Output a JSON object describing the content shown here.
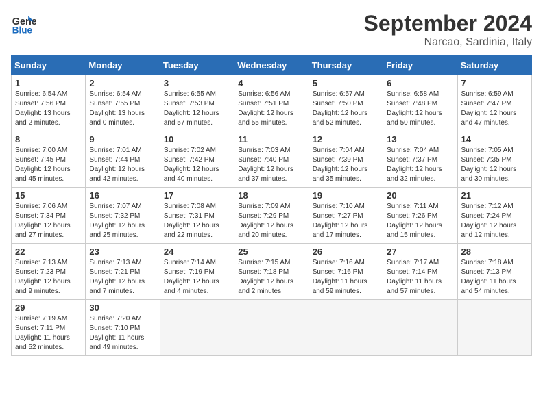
{
  "header": {
    "logo_line1": "General",
    "logo_line2": "Blue",
    "month": "September 2024",
    "location": "Narcao, Sardinia, Italy"
  },
  "weekdays": [
    "Sunday",
    "Monday",
    "Tuesday",
    "Wednesday",
    "Thursday",
    "Friday",
    "Saturday"
  ],
  "weeks": [
    [
      {
        "num": "1",
        "rise": "6:54 AM",
        "set": "7:56 PM",
        "daylight": "13 hours and 2 minutes."
      },
      {
        "num": "2",
        "rise": "6:54 AM",
        "set": "7:55 PM",
        "daylight": "13 hours and 0 minutes."
      },
      {
        "num": "3",
        "rise": "6:55 AM",
        "set": "7:53 PM",
        "daylight": "12 hours and 57 minutes."
      },
      {
        "num": "4",
        "rise": "6:56 AM",
        "set": "7:51 PM",
        "daylight": "12 hours and 55 minutes."
      },
      {
        "num": "5",
        "rise": "6:57 AM",
        "set": "7:50 PM",
        "daylight": "12 hours and 52 minutes."
      },
      {
        "num": "6",
        "rise": "6:58 AM",
        "set": "7:48 PM",
        "daylight": "12 hours and 50 minutes."
      },
      {
        "num": "7",
        "rise": "6:59 AM",
        "set": "7:47 PM",
        "daylight": "12 hours and 47 minutes."
      }
    ],
    [
      {
        "num": "8",
        "rise": "7:00 AM",
        "set": "7:45 PM",
        "daylight": "12 hours and 45 minutes."
      },
      {
        "num": "9",
        "rise": "7:01 AM",
        "set": "7:44 PM",
        "daylight": "12 hours and 42 minutes."
      },
      {
        "num": "10",
        "rise": "7:02 AM",
        "set": "7:42 PM",
        "daylight": "12 hours and 40 minutes."
      },
      {
        "num": "11",
        "rise": "7:03 AM",
        "set": "7:40 PM",
        "daylight": "12 hours and 37 minutes."
      },
      {
        "num": "12",
        "rise": "7:04 AM",
        "set": "7:39 PM",
        "daylight": "12 hours and 35 minutes."
      },
      {
        "num": "13",
        "rise": "7:04 AM",
        "set": "7:37 PM",
        "daylight": "12 hours and 32 minutes."
      },
      {
        "num": "14",
        "rise": "7:05 AM",
        "set": "7:35 PM",
        "daylight": "12 hours and 30 minutes."
      }
    ],
    [
      {
        "num": "15",
        "rise": "7:06 AM",
        "set": "7:34 PM",
        "daylight": "12 hours and 27 minutes."
      },
      {
        "num": "16",
        "rise": "7:07 AM",
        "set": "7:32 PM",
        "daylight": "12 hours and 25 minutes."
      },
      {
        "num": "17",
        "rise": "7:08 AM",
        "set": "7:31 PM",
        "daylight": "12 hours and 22 minutes."
      },
      {
        "num": "18",
        "rise": "7:09 AM",
        "set": "7:29 PM",
        "daylight": "12 hours and 20 minutes."
      },
      {
        "num": "19",
        "rise": "7:10 AM",
        "set": "7:27 PM",
        "daylight": "12 hours and 17 minutes."
      },
      {
        "num": "20",
        "rise": "7:11 AM",
        "set": "7:26 PM",
        "daylight": "12 hours and 15 minutes."
      },
      {
        "num": "21",
        "rise": "7:12 AM",
        "set": "7:24 PM",
        "daylight": "12 hours and 12 minutes."
      }
    ],
    [
      {
        "num": "22",
        "rise": "7:13 AM",
        "set": "7:23 PM",
        "daylight": "12 hours and 9 minutes."
      },
      {
        "num": "23",
        "rise": "7:13 AM",
        "set": "7:21 PM",
        "daylight": "12 hours and 7 minutes."
      },
      {
        "num": "24",
        "rise": "7:14 AM",
        "set": "7:19 PM",
        "daylight": "12 hours and 4 minutes."
      },
      {
        "num": "25",
        "rise": "7:15 AM",
        "set": "7:18 PM",
        "daylight": "12 hours and 2 minutes."
      },
      {
        "num": "26",
        "rise": "7:16 AM",
        "set": "7:16 PM",
        "daylight": "11 hours and 59 minutes."
      },
      {
        "num": "27",
        "rise": "7:17 AM",
        "set": "7:14 PM",
        "daylight": "11 hours and 57 minutes."
      },
      {
        "num": "28",
        "rise": "7:18 AM",
        "set": "7:13 PM",
        "daylight": "11 hours and 54 minutes."
      }
    ],
    [
      {
        "num": "29",
        "rise": "7:19 AM",
        "set": "7:11 PM",
        "daylight": "11 hours and 52 minutes."
      },
      {
        "num": "30",
        "rise": "7:20 AM",
        "set": "7:10 PM",
        "daylight": "11 hours and 49 minutes."
      },
      null,
      null,
      null,
      null,
      null
    ]
  ]
}
